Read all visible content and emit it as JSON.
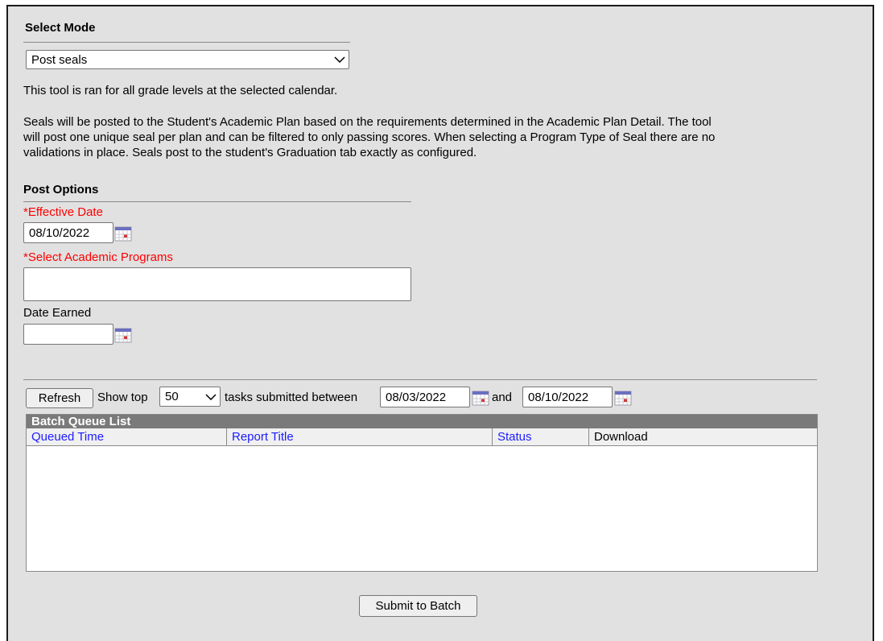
{
  "select_mode": {
    "header": "Select Mode",
    "selected": "Post seals"
  },
  "info": {
    "line1": "This tool is ran for all grade levels at the selected calendar.",
    "para_l1": "Seals will be posted to the Student's Academic Plan based on the requirements determined in the Academic Plan Detail. The tool",
    "para_l2": "will post one unique seal per plan and can be filtered to only passing scores. When selecting a Program Type of Seal there are no",
    "para_l3": "validations in place. Seals post to the student's Graduation tab exactly as configured."
  },
  "post_options": {
    "header": "Post Options",
    "effective_date_label": "*Effective Date",
    "effective_date_value": "08/10/2022",
    "academic_programs_label": "*Select Academic Programs",
    "date_earned_label": "Date Earned",
    "date_earned_value": ""
  },
  "batch_toolbar": {
    "refresh_label": "Refresh",
    "show_top_label": "Show top",
    "show_top_value": "50",
    "between_label": "tasks submitted between",
    "start_date": "08/03/2022",
    "and_label": "and",
    "end_date": "08/10/2022"
  },
  "batch_queue": {
    "title": "Batch Queue List",
    "columns": [
      "Queued Time",
      "Report Title",
      "Status",
      "Download"
    ]
  },
  "submit_label": "Submit to Batch"
}
